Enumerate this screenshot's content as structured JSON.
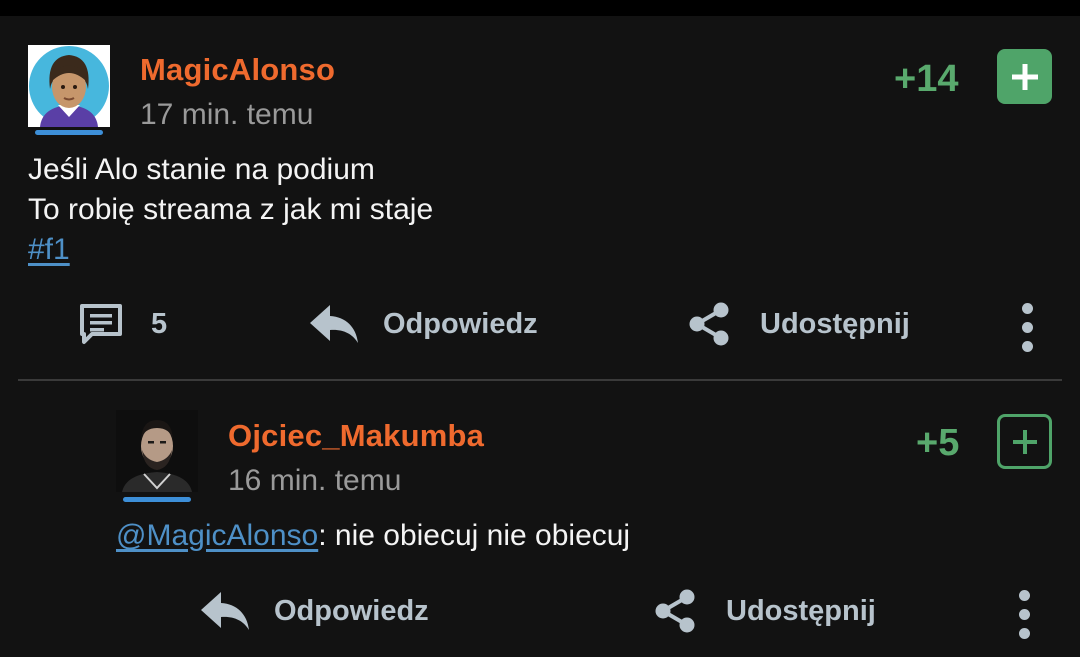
{
  "entry": {
    "author": "MagicAlonso",
    "time": "17 min. temu",
    "score": "+14",
    "plus_icon": "plus-icon",
    "body_lines": [
      "Jeśli Alo stanie na podium",
      "To robię streama z jak mi staje"
    ],
    "tag": "#f1",
    "comments_count": "5",
    "reply_label": "Odpowiedz",
    "share_label": "Udostępnij"
  },
  "reply": {
    "author": "Ojciec_Makumba",
    "time": "16 min. temu",
    "score": "+5",
    "mention": "@MagicAlonso",
    "text": ": nie obiecuj nie obiecuj",
    "reply_label": "Odpowiedz",
    "share_label": "Udostępnij"
  },
  "colors": {
    "background": "#121212",
    "author": "#ef6a2e",
    "score": "#59a96d",
    "link": "#4e90c7",
    "action": "#b7c3cc"
  }
}
